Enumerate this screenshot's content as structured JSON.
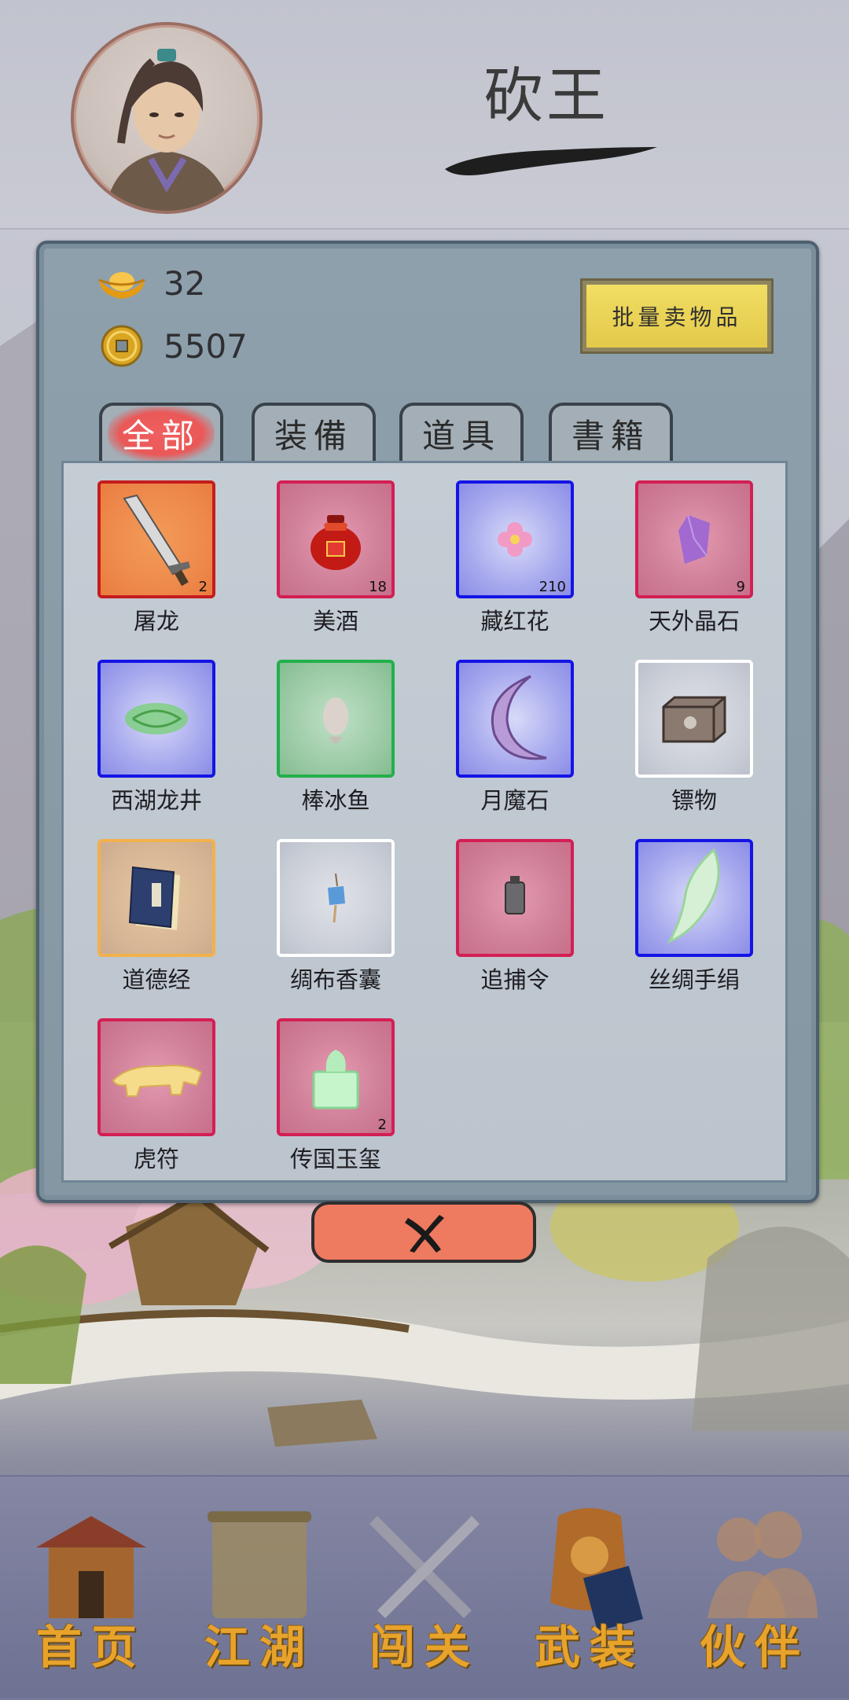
{
  "header": {
    "player_name": "砍王"
  },
  "currency": {
    "gold_ingots": "32",
    "coins": "5507"
  },
  "bulk_sell_label": "批量卖物品",
  "tabs": [
    {
      "label": "全部",
      "active": true
    },
    {
      "label": "装備",
      "active": false
    },
    {
      "label": "道具",
      "active": false
    },
    {
      "label": "書籍",
      "active": false
    }
  ],
  "items": [
    {
      "name": "屠龙",
      "count": "2",
      "rarity": "orange",
      "icon": "sword-icon"
    },
    {
      "name": "美酒",
      "count": "18",
      "rarity": "red",
      "icon": "wine-jar-icon"
    },
    {
      "name": "藏红花",
      "count": "210",
      "rarity": "blue",
      "icon": "flower-icon"
    },
    {
      "name": "天外晶石",
      "count": "9",
      "rarity": "red",
      "icon": "crystal-icon"
    },
    {
      "name": "西湖龙井",
      "count": "",
      "rarity": "blue",
      "icon": "tea-leaves-icon"
    },
    {
      "name": "棒冰鱼",
      "count": "",
      "rarity": "green",
      "icon": "fish-icon"
    },
    {
      "name": "月魔石",
      "count": "",
      "rarity": "blue",
      "icon": "moon-stone-icon"
    },
    {
      "name": "镖物",
      "count": "",
      "rarity": "white",
      "icon": "cargo-box-icon"
    },
    {
      "name": "道德经",
      "count": "",
      "rarity": "gold",
      "icon": "book-icon"
    },
    {
      "name": "绸布香囊",
      "count": "",
      "rarity": "white",
      "icon": "sachet-icon"
    },
    {
      "name": "追捕令",
      "count": "",
      "rarity": "red",
      "icon": "token-icon"
    },
    {
      "name": "丝绸手绢",
      "count": "",
      "rarity": "blue",
      "icon": "silk-handkerchief-icon"
    },
    {
      "name": "虎符",
      "count": "",
      "rarity": "red",
      "icon": "tiger-tally-icon"
    },
    {
      "name": "传国玉玺",
      "count": "2",
      "rarity": "red",
      "icon": "jade-seal-icon"
    }
  ],
  "nav": [
    {
      "label": "首页",
      "icon": "house-icon"
    },
    {
      "label": "江湖",
      "icon": "scroll-map-icon"
    },
    {
      "label": "闯关",
      "icon": "crossed-swords-icon"
    },
    {
      "label": "武装",
      "icon": "armor-icon"
    },
    {
      "label": "伙伴",
      "icon": "companions-icon"
    }
  ]
}
